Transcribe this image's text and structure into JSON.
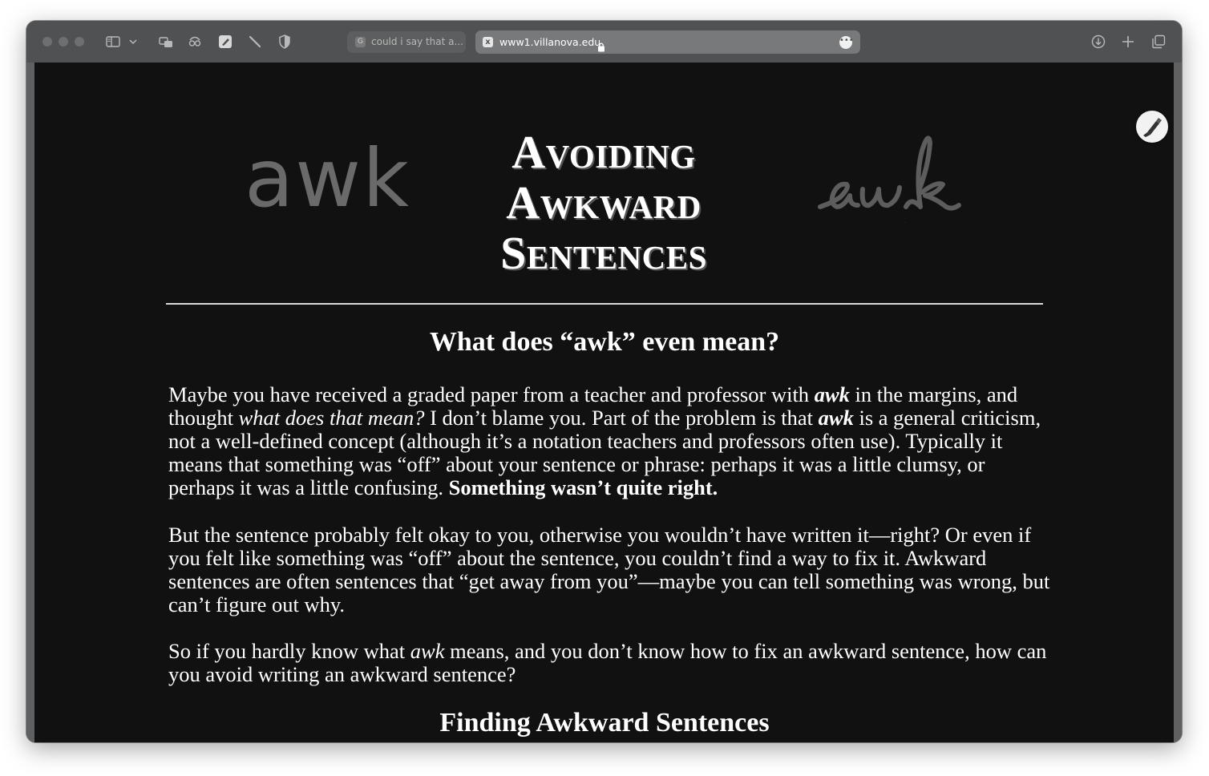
{
  "browser": {
    "tabs": [
      {
        "favicon": "G",
        "label": "could i say that a..."
      },
      {
        "favicon": "x",
        "label": "www1.villanova.edu"
      }
    ],
    "icons": [
      "sidebar-icon",
      "chevron-down-icon",
      "tab-overview-icon",
      "privacy-report-icon",
      "highlighter-icon",
      "pen-icon",
      "shield-icon",
      "download-icon",
      "plus-icon",
      "tabs-icon",
      "more-icon",
      "lock-icon"
    ]
  },
  "page": {
    "logo_left": "awk",
    "logo_right": "awk",
    "title_line1": "Avoiding",
    "title_line2": "Awkward",
    "title_line3": "Sentences",
    "heading1": "What does “awk” even mean?",
    "p1": {
      "t1": "Maybe you have received a graded paper from a teacher and professor with ",
      "awk1": "awk",
      "t2": " in the margins, and thought ",
      "italic1": "what does that mean?",
      "t3": " I don’t blame you. Part of the problem is that ",
      "awk2": "awk",
      "t4": " is a general criticism, not a well-defined concept (although it’s a notation teachers and professors often use). Typically it means that something was “off” about your sentence or phrase: perhaps it was a little clumsy, or perhaps it was a little confusing. ",
      "bold": "Something wasn’t quite right."
    },
    "p2": "But the sentence probably felt okay to you, otherwise you wouldn’t have written it—right? Or even if you felt like something was “off” about the sentence, you couldn’t find a way to fix it. Awkward sentences are often sentences that “get away from you”—maybe you can tell something was wrong, but can’t figure out why.",
    "p3": {
      "t1": "So if you hardly know what ",
      "italic": "awk",
      "t2": " means, and you don’t know how to fix an awkward sentence, how can you avoid writing an awkward sentence?"
    },
    "heading2": "Finding Awkward Sentences"
  }
}
